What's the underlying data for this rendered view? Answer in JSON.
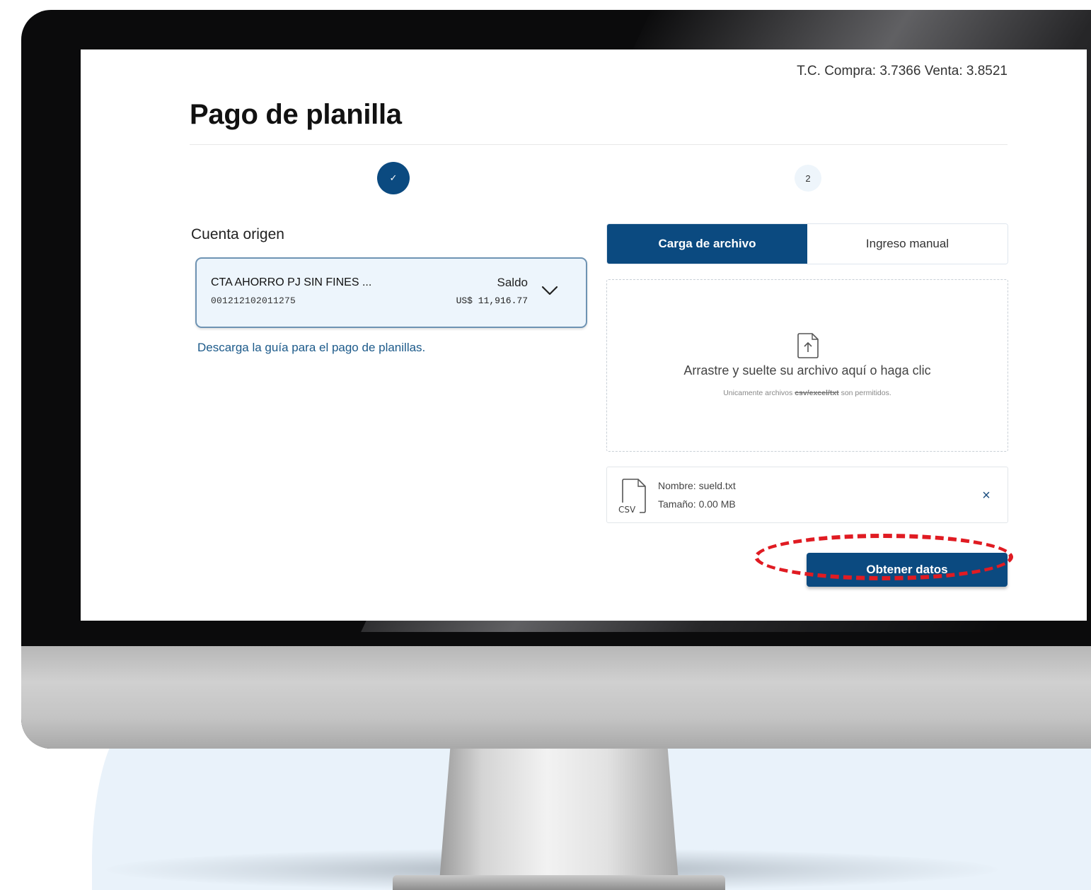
{
  "exchange_rate": "T.C. Compra: 3.7366 Venta: 3.8521",
  "page_title": "Pago de planilla",
  "steps": {
    "step1_icon": "✓",
    "step2_label": "2"
  },
  "origin": {
    "label": "Cuenta origen",
    "account_name": "CTA AHORRO PJ SIN FINES ...",
    "account_number": "001212102011275",
    "balance_label": "Saldo",
    "balance_value": "US$ 11,916.77",
    "expand_icon": "chevron-down-icon"
  },
  "guide_link": "Descarga la guía para el pago de planillas.",
  "tabs": [
    {
      "label": "Carga de archivo",
      "active": true
    },
    {
      "label": "Ingreso manual",
      "active": false
    }
  ],
  "dropzone": {
    "icon": "upload-icon",
    "main_text": "Arrastre y suelte su archivo aquí o haga clic",
    "sub_prefix": "Unicamente archivos ",
    "sub_formats": "csv/excel/txt",
    "sub_suffix": " son permitidos."
  },
  "file": {
    "icon": "csv-file-icon",
    "icon_label": "CSV",
    "name": "Nombre: sueld.txt",
    "size": "Tamaño: 0.00 MB",
    "remove_icon": "close-icon",
    "remove_glyph": "×"
  },
  "actions": {
    "submit_label": "Obtener datos"
  },
  "colors": {
    "primary": "#0b4a80",
    "highlight": "#e01b22",
    "account_bg": "#edf5fc",
    "link": "#1c5a8a"
  }
}
